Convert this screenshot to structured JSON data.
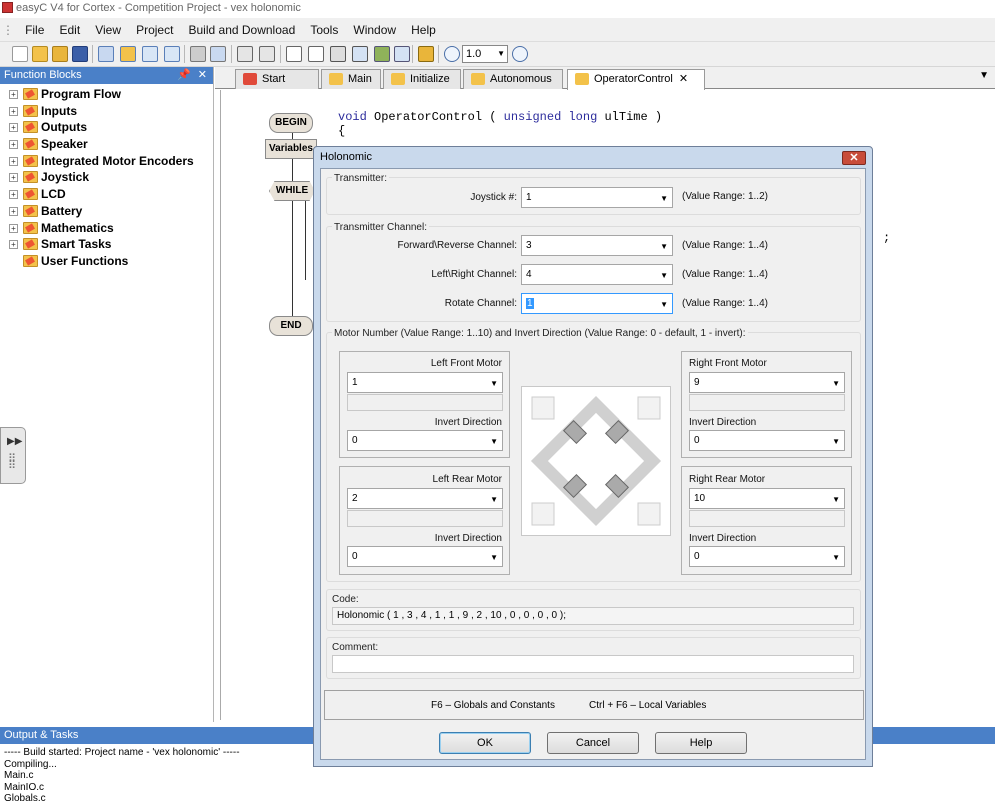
{
  "app": {
    "title": "easyC V4 for Cortex - Competition Project - vex holonomic"
  },
  "menu": [
    "File",
    "Edit",
    "View",
    "Project",
    "Build and Download",
    "Tools",
    "Window",
    "Help"
  ],
  "toolbar": {
    "zoom": "1.0"
  },
  "function_blocks": {
    "title": "Function Blocks",
    "items": [
      "Program Flow",
      "Inputs",
      "Outputs",
      "Speaker",
      "Integrated Motor Encoders",
      "Joystick",
      "LCD",
      "Battery",
      "Mathematics",
      "Smart Tasks",
      "User Functions"
    ]
  },
  "tabs": [
    "Start Page",
    "Main",
    "Initialize",
    "Autonomous",
    "OperatorControl"
  ],
  "editor": {
    "signature_kw1": "void",
    "signature_fn": "OperatorControl",
    "signature_open": "(",
    "signature_kw2": "unsigned long",
    "signature_param": "ulTime",
    "signature_close": ")",
    "brace": "{",
    "semicolon": ";",
    "blocks": {
      "begin": "BEGIN",
      "variables": "Variables",
      "while": "WHILE",
      "end": "END"
    }
  },
  "output": {
    "title": "Output & Tasks",
    "lines": [
      "----- Build started: Project name - 'vex holonomic' -----",
      "Compiling...",
      "Main.c",
      "MainIO.c",
      "Globals.c"
    ]
  },
  "dialog": {
    "title": "Holonomic",
    "transmitter": {
      "label": "Transmitter:",
      "joystick_label": "Joystick #:",
      "joystick_value": "1",
      "joystick_range": "(Value Range: 1..2)"
    },
    "channel": {
      "label": "Transmitter Channel:",
      "forward_label": "Forward\\Reverse Channel:",
      "forward_value": "3",
      "forward_range": "(Value Range: 1..4)",
      "left_label": "Left\\Right Channel:",
      "left_value": "4",
      "left_range": "(Value Range: 1..4)",
      "rotate_label": "Rotate Channel:",
      "rotate_value": "1",
      "rotate_range": "(Value Range: 1..4)"
    },
    "motors": {
      "label": "Motor Number (Value Range: 1..10)  and  Invert Direction (Value Range: 0 - default, 1 - invert):",
      "invert_label": "Invert Direction",
      "left_front": {
        "label": "Left Front Motor",
        "motor": "1",
        "invert": "0"
      },
      "right_front": {
        "label": "Right Front Motor",
        "motor": "9",
        "invert": "0"
      },
      "left_rear": {
        "label": "Left Rear Motor",
        "motor": "2",
        "invert": "0"
      },
      "right_rear": {
        "label": "Right Rear Motor",
        "motor": "10",
        "invert": "0"
      }
    },
    "code": {
      "label": "Code:",
      "value": "Holonomic ( 1 , 3 , 4 , 1 , 1 , 9 , 2 , 10 , 0 , 0 , 0 , 0 );"
    },
    "comment": {
      "label": "Comment:",
      "value": ""
    },
    "hints": {
      "globals": "F6 – Globals and Constants",
      "locals": "Ctrl + F6 – Local Variables"
    },
    "buttons": {
      "ok": "OK",
      "cancel": "Cancel",
      "help": "Help"
    }
  },
  "colors": {
    "panel_header": "#4a80c8",
    "dialog_frame": "#c9d9ec",
    "close_button": "#c84c3a"
  }
}
